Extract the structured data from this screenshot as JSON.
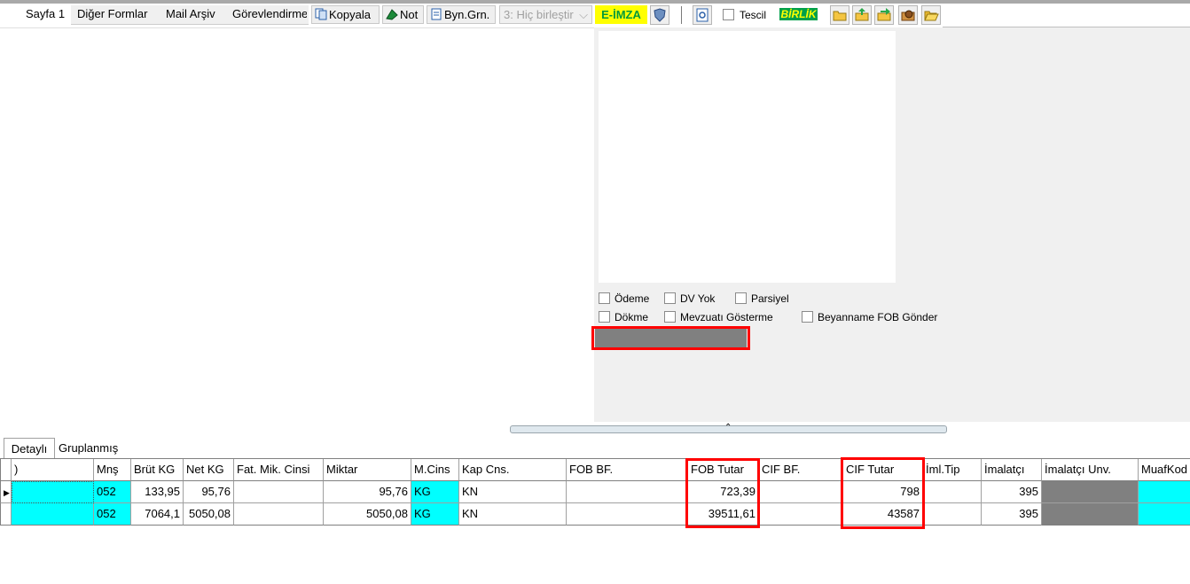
{
  "toolbar": {
    "page_tab": "Sayfa 1",
    "other_forms": "Diğer Formlar",
    "mail_archive": "Mail Arşiv",
    "assignment": "Görevlendirme",
    "copy_button": "Kopyala",
    "note_button": "Not",
    "byn_button": "Byn.Grn.",
    "merge_select": "3: Hiç birleştir",
    "e_sign": "E-İMZA",
    "tescil_label": "Tescil",
    "birlik_label": "BİRLİK",
    "accent_yellow": "#ffff00",
    "birlik_green": "#00a04a"
  },
  "options": {
    "odeme": "Ödeme",
    "dv_yok": "DV Yok",
    "parsiyel": "Parsiyel",
    "dokme": "Dökme",
    "mevzuati": "Mevzuatı Gösterme",
    "beyanname": "Beyanname FOB Gönder"
  },
  "bottom_tabs": {
    "detailed": "Detaylı",
    "grouped": "Gruplanmış"
  },
  "grid": {
    "headers": {
      "c0": ")",
      "mns": "Mnş",
      "brut": "Brüt KG",
      "net": "Net KG",
      "fat": "Fat. Mik. Cinsi",
      "miktar": "Miktar",
      "mcins": "M.Cins",
      "kap": "Kap Cns.",
      "fobbf": "FOB BF.",
      "fobtutar": "FOB Tutar",
      "cifbf": "CIF BF.",
      "ciftutar": "CIF Tutar",
      "imltip": "İml.Tip",
      "imalatci": "İmalatçı",
      "imalatciunv": "İmalatçı Unv.",
      "muafkod": "MuafKod"
    },
    "rows": [
      {
        "mns": "052",
        "brut": "133,95",
        "net": "95,76",
        "fat": "",
        "miktar": "95,76",
        "mcins": "KG",
        "kap": "KN",
        "fobbf": "",
        "fobtutar": "723,39",
        "cifbf": "",
        "ciftutar": "798",
        "imltip": "",
        "imalatci": "395"
      },
      {
        "mns": "052",
        "brut": "7064,1",
        "net": "5050,08",
        "fat": "",
        "miktar": "5050,08",
        "mcins": "KG",
        "kap": "KN",
        "fobbf": "",
        "fobtutar": "39511,61",
        "cifbf": "",
        "ciftutar": "43587",
        "imltip": "",
        "imalatci": "395"
      }
    ]
  }
}
